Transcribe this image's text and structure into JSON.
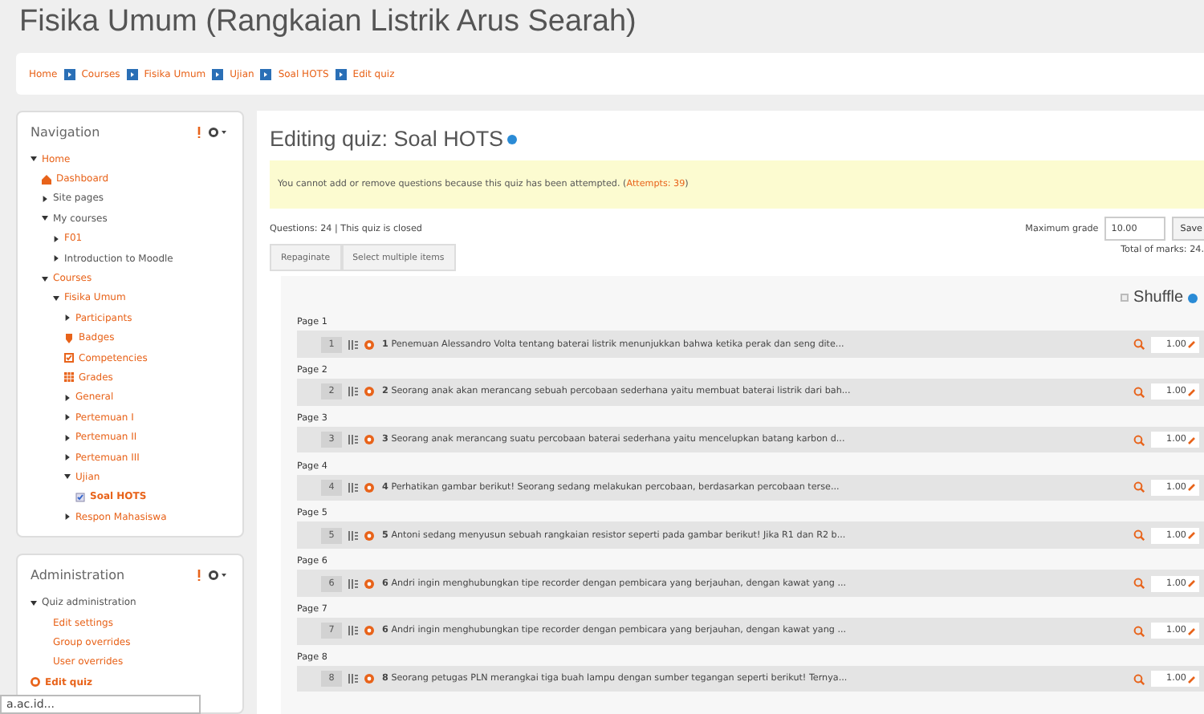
{
  "page_title": "Fisika Umum (Rangkaian Listrik Arus Searah)",
  "breadcrumb": [
    "Home",
    "Courses",
    "Fisika Umum",
    "Ujian",
    "Soal HOTS",
    "Edit quiz"
  ],
  "navigation": {
    "title": "Navigation",
    "items": [
      {
        "label": "Home",
        "kind": "branch",
        "expanded": true,
        "link": true,
        "selected": false,
        "children": [
          {
            "label": "Dashboard",
            "kind": "dashboard",
            "link": true,
            "selected": false
          },
          {
            "label": "Site pages",
            "kind": "branch",
            "expanded": false,
            "link": false,
            "selected": false
          },
          {
            "label": "My courses",
            "kind": "branch",
            "expanded": true,
            "link": false,
            "selected": false,
            "children": [
              {
                "label": "F01",
                "kind": "branch",
                "expanded": false,
                "link": true,
                "selected": false
              },
              {
                "label": "Introduction to Moodle",
                "kind": "branch",
                "expanded": false,
                "link": false,
                "selected": false
              }
            ]
          },
          {
            "label": "Courses",
            "kind": "branch",
            "expanded": true,
            "link": true,
            "selected": false,
            "children": [
              {
                "label": "Fisika Umum",
                "kind": "branch",
                "expanded": true,
                "link": true,
                "selected": false,
                "children": [
                  {
                    "label": "Participants",
                    "kind": "branch",
                    "expanded": false,
                    "link": true,
                    "selected": false
                  },
                  {
                    "label": "Badges",
                    "kind": "badge",
                    "link": true,
                    "selected": false
                  },
                  {
                    "label": "Competencies",
                    "kind": "checkbox",
                    "link": true,
                    "selected": false
                  },
                  {
                    "label": "Grades",
                    "kind": "table",
                    "link": true,
                    "selected": false
                  },
                  {
                    "label": "General",
                    "kind": "branch",
                    "expanded": false,
                    "link": true,
                    "selected": false
                  },
                  {
                    "label": "Pertemuan I",
                    "kind": "branch",
                    "expanded": false,
                    "link": true,
                    "selected": false
                  },
                  {
                    "label": "Pertemuan II",
                    "kind": "branch",
                    "expanded": false,
                    "link": true,
                    "selected": false
                  },
                  {
                    "label": "Pertemuan III",
                    "kind": "branch",
                    "expanded": false,
                    "link": true,
                    "selected": false
                  },
                  {
                    "label": "Ujian",
                    "kind": "branch",
                    "expanded": true,
                    "link": true,
                    "selected": false,
                    "children": [
                      {
                        "label": "Soal HOTS",
                        "kind": "quiz",
                        "link": true,
                        "selected": true
                      }
                    ]
                  },
                  {
                    "label": "Respon Mahasiswa",
                    "kind": "branch",
                    "expanded": false,
                    "link": true,
                    "selected": false
                  }
                ]
              }
            ]
          }
        ]
      }
    ]
  },
  "administration": {
    "title": "Administration",
    "items": [
      {
        "label": "Quiz administration",
        "kind": "branch",
        "expanded": true,
        "link": false,
        "selected": false,
        "children": [
          {
            "label": "Edit settings",
            "kind": "plain",
            "link": true,
            "selected": false
          },
          {
            "label": "Group overrides",
            "kind": "plain",
            "link": true,
            "selected": false
          },
          {
            "label": "User overrides",
            "kind": "plain",
            "link": true,
            "selected": false
          }
        ]
      },
      {
        "label": "Edit quiz",
        "kind": "gear",
        "link": true,
        "selected": true
      }
    ]
  },
  "status_bar": "a.ac.id...",
  "heading": "Editing quiz: Soal HOTS",
  "notice": {
    "text": "You cannot add or remove questions because this quiz has been attempted. (",
    "link": "Attempts: 39",
    "end": ")"
  },
  "summary": "Questions: 24 | This quiz is closed",
  "maximum_grade": {
    "label": "Maximum grade",
    "value": "10.00",
    "button": "Save"
  },
  "buttons": [
    "Repaginate",
    "Select multiple items"
  ],
  "total_marks": "Total of marks: 24.",
  "shuffle": {
    "label": "Shuffle",
    "checked": false
  },
  "pages": [
    {
      "label": "Page 1",
      "slot": "1",
      "number": "1",
      "text": "Penemuan Alessandro Volta tentang baterai listrik menunjukkan bahwa ketika perak dan seng dite...",
      "mark": "1.00"
    },
    {
      "label": "Page 2",
      "slot": "2",
      "number": "2",
      "text": "Seorang anak akan merancang sebuah percobaan sederhana yaitu membuat baterai listrik dari bah...",
      "mark": "1.00"
    },
    {
      "label": "Page 3",
      "slot": "3",
      "number": "3",
      "text": "Seorang anak merancang suatu percobaan baterai sederhana yaitu mencelupkan batang karbon d...",
      "mark": "1.00"
    },
    {
      "label": "Page 4",
      "slot": "4",
      "number": "4",
      "text": "Perhatikan gambar berikut!   Seorang sedang melakukan percobaan, berdasarkan percobaan terse...",
      "mark": "1.00"
    },
    {
      "label": "Page 5",
      "slot": "5",
      "number": "5",
      "text": "Antoni sedang menyusun sebuah rangkaian resistor seperti pada gambar berikut! Jika R1 dan R2 b...",
      "mark": "1.00"
    },
    {
      "label": "Page 6",
      "slot": "6",
      "number": "6",
      "text": "Andri ingin menghubungkan tipe recorder dengan pembicara yang berjauhan, dengan kawat yang ...",
      "mark": "1.00"
    },
    {
      "label": "Page 7",
      "slot": "7",
      "number": "6",
      "text": "Andri ingin menghubungkan tipe recorder dengan pembicara yang berjauhan, dengan kawat yang ...",
      "mark": "1.00"
    },
    {
      "label": "Page 8",
      "slot": "8",
      "number": "8",
      "text": "Seorang petugas PLN merangkai tiga buah lampu dengan sumber tegangan seperti berikut! Ternya...",
      "mark": "1.00"
    }
  ]
}
